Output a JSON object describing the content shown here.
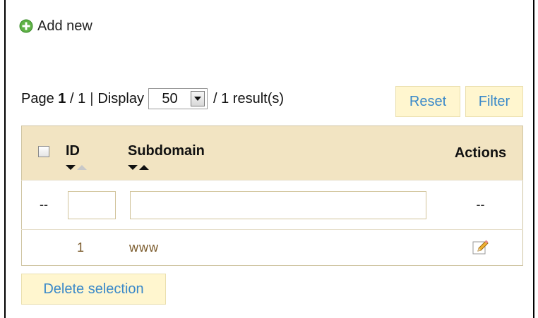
{
  "toolbar": {
    "add_new_label": "Add new"
  },
  "pager": {
    "page_prefix": "Page",
    "current_page": "1",
    "page_sep": "/ 1",
    "sep": "|",
    "display_label": "Display",
    "display_value": "50",
    "results_text": "/ 1 result(s)"
  },
  "buttons": {
    "reset": "Reset",
    "filter": "Filter",
    "delete_selection": "Delete selection"
  },
  "table": {
    "columns": {
      "id": "ID",
      "subdomain": "Subdomain",
      "actions": "Actions"
    },
    "filter_row": {
      "left_dash": "--",
      "actions_dash": "--"
    },
    "rows": [
      {
        "id": "1",
        "subdomain": "www"
      }
    ]
  },
  "colors": {
    "header_bg": "#f2e4c2",
    "button_bg": "#fff6cf",
    "link_blue": "#3a89c9",
    "cell_text": "#7b5b2c"
  }
}
